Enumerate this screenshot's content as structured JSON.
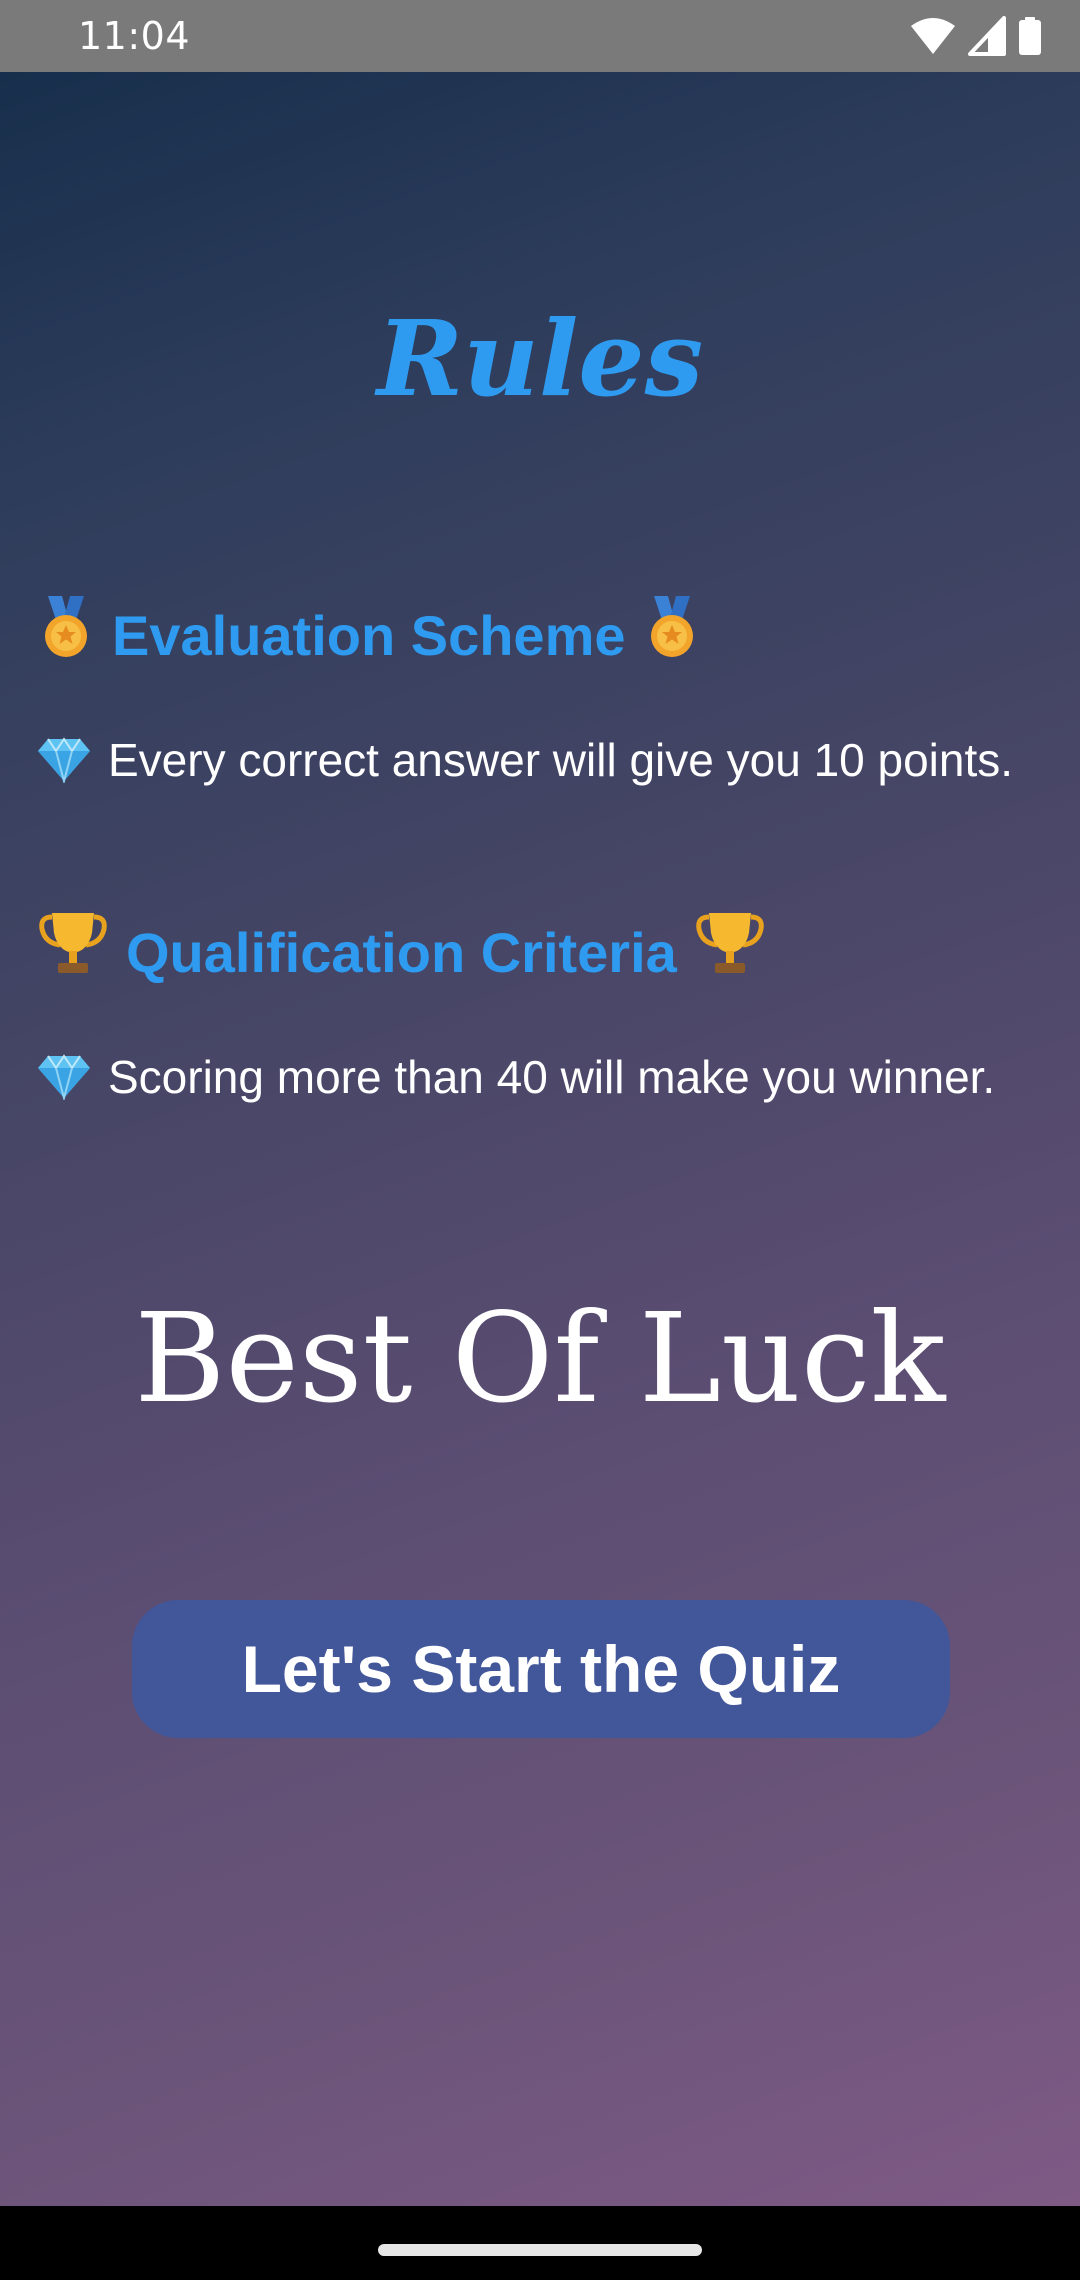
{
  "status_bar": {
    "time": "11:04",
    "icons": [
      "wifi-icon",
      "signal-icon",
      "battery-icon"
    ]
  },
  "rules": {
    "title": "Rules",
    "evaluation": {
      "heading": "Evaluation Scheme",
      "heading_icon": "medal-icon",
      "rule": "Every correct answer will give you 10 points.",
      "rule_icon": "gem-icon"
    },
    "qualification": {
      "heading": "Qualification Criteria",
      "heading_icon": "trophy-icon",
      "rule": "Scoring more than 40 will make you winner.",
      "rule_icon": "gem-icon"
    },
    "luck_text": "Best Of Luck",
    "start_button": "Let's Start the Quiz"
  },
  "colors": {
    "accent": "#2e9bf0",
    "button": "#42569a",
    "gradient_top": "#172f4c",
    "gradient_bottom": "#7e5a85"
  }
}
